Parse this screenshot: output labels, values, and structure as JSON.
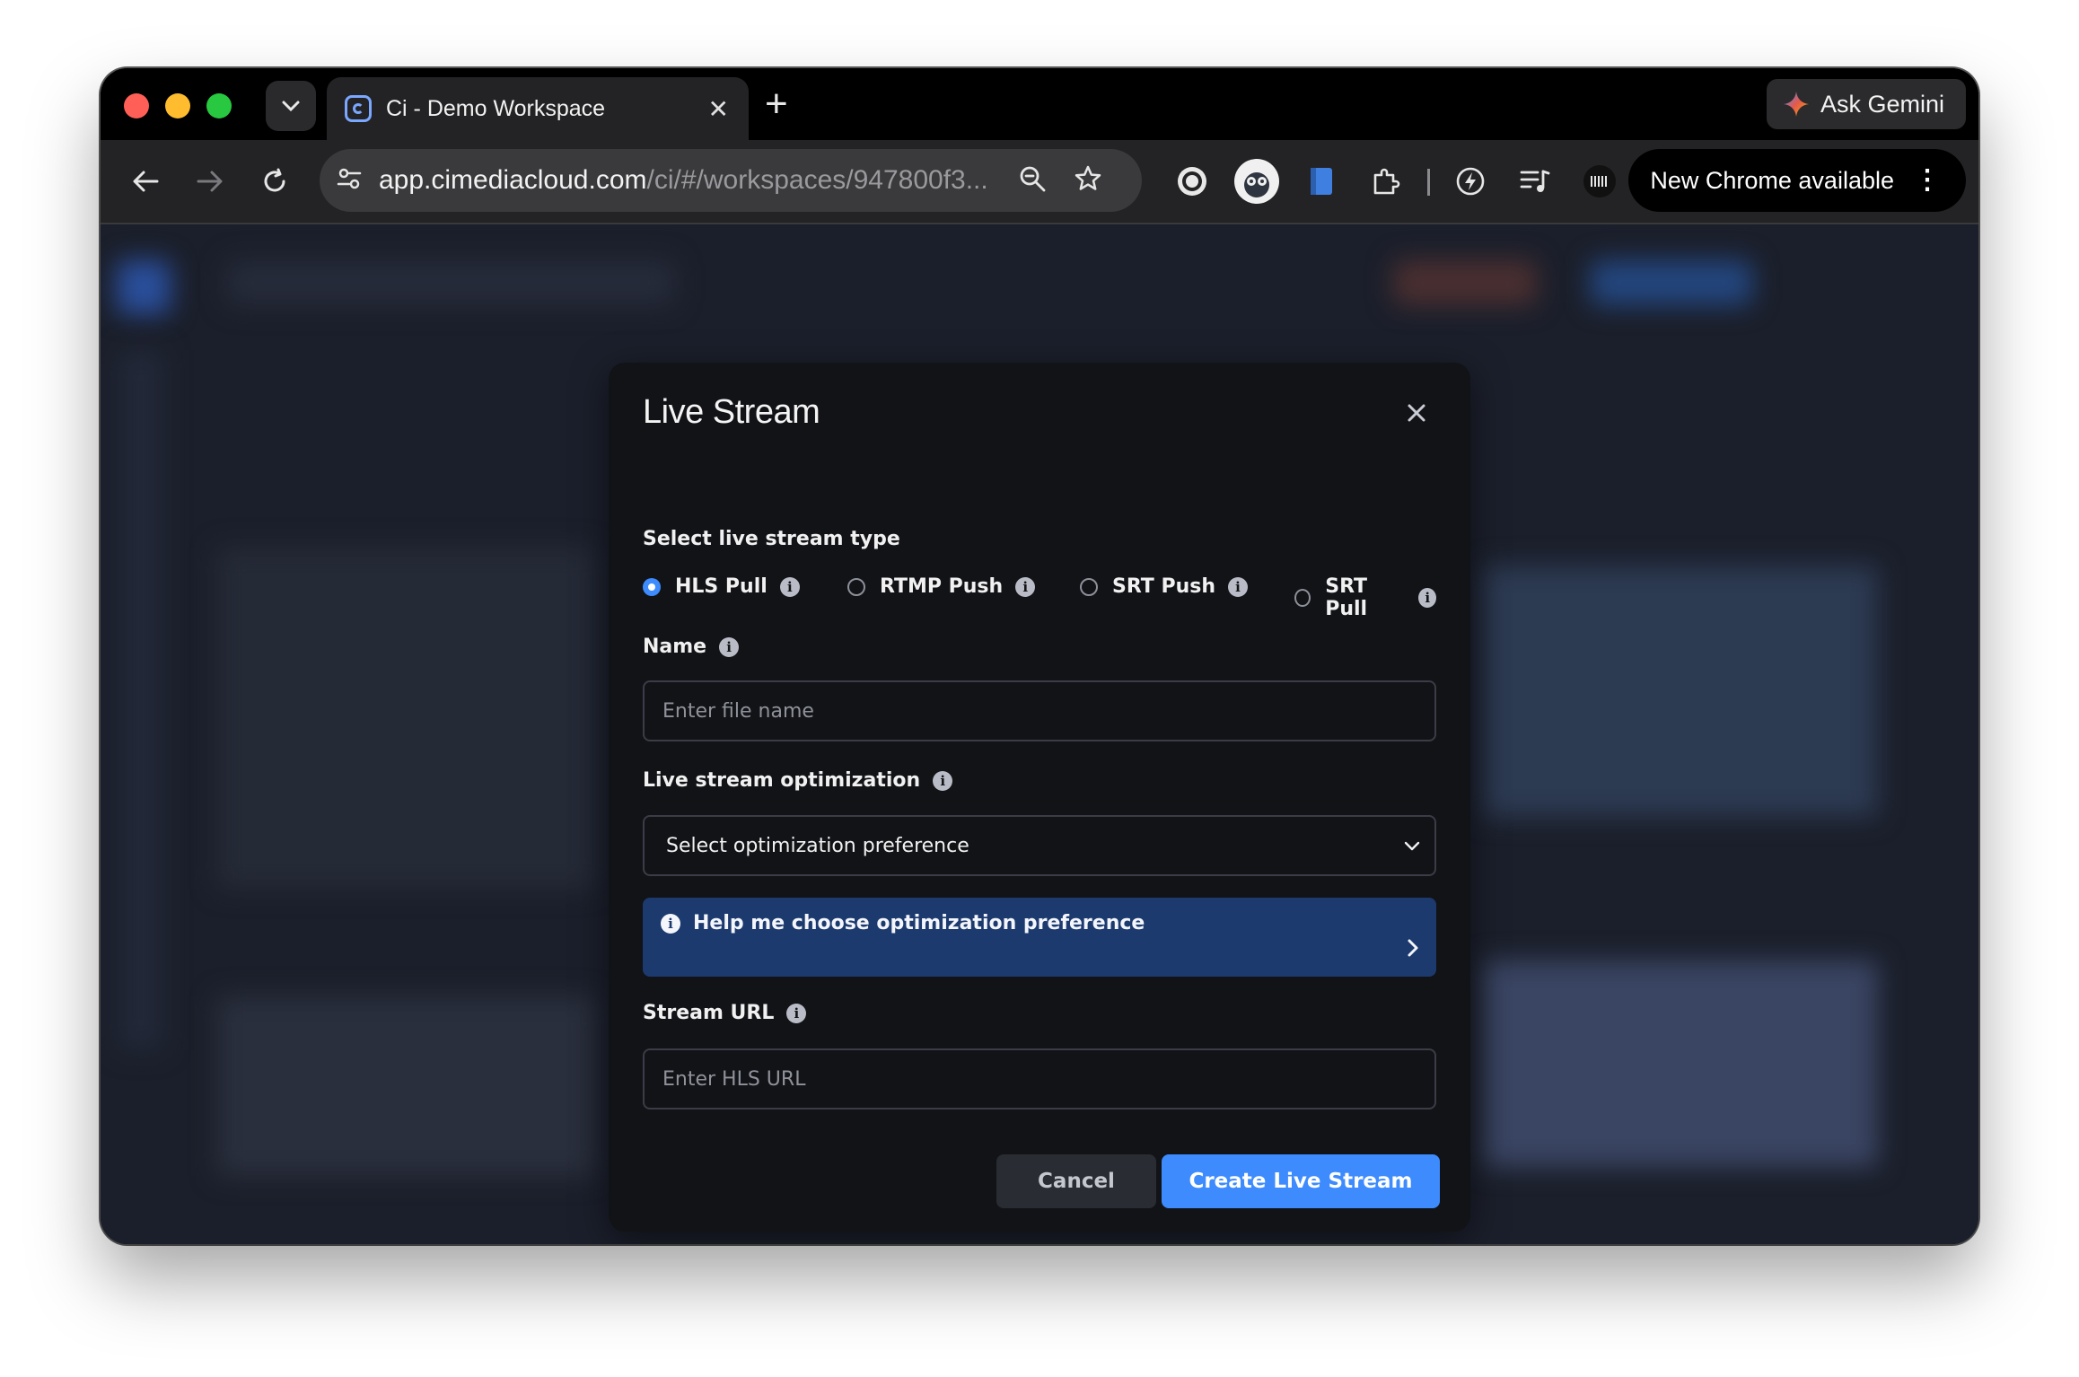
{
  "browser": {
    "tab": {
      "title": "Ci - Demo Workspace"
    },
    "new_tab_symbol": "+",
    "gemini_label": "Ask Gemini",
    "url_host": "app.cimediacloud.com",
    "url_path": "/ci/#/workspaces/947800f3...",
    "update_label": "New Chrome available",
    "colors": {
      "close": "#ff5f57",
      "minimize": "#febc2e",
      "maximize": "#28c840"
    }
  },
  "modal": {
    "title": "Live Stream",
    "stream_type_label": "Select live stream type",
    "stream_types": [
      {
        "label": "HLS Pull",
        "selected": true
      },
      {
        "label": "RTMP Push",
        "selected": false
      },
      {
        "label": "SRT Push",
        "selected": false
      },
      {
        "label": "SRT Pull",
        "selected": false
      }
    ],
    "name_label": "Name",
    "name_placeholder": "Enter file name",
    "optimization_label": "Live stream optimization",
    "optimization_value": "Select optimization preference",
    "help_text": "Help me choose optimization preference",
    "url_label": "Stream URL",
    "url_placeholder": "Enter HLS URL",
    "cancel_label": "Cancel",
    "create_label": "Create Live Stream",
    "colors": {
      "accent": "#3d8bfd",
      "help_bg": "#1c3a6e",
      "modal_bg": "#121317"
    }
  }
}
